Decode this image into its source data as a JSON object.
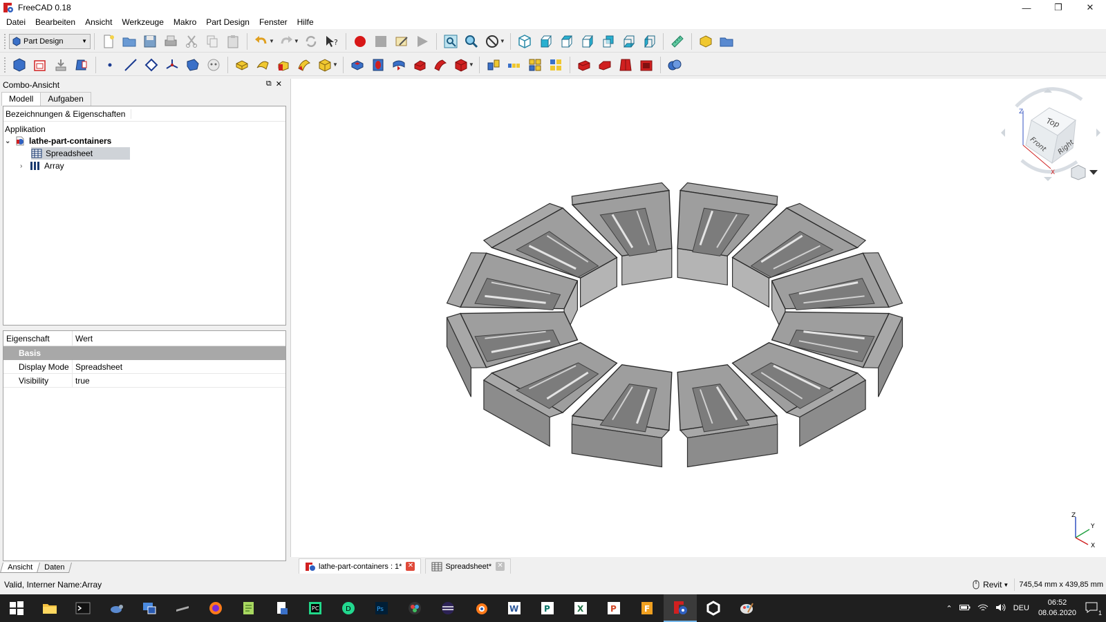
{
  "window": {
    "title": "FreeCAD 0.18"
  },
  "menu": [
    "Datei",
    "Bearbeiten",
    "Ansicht",
    "Werkzeuge",
    "Makro",
    "Part Design",
    "Fenster",
    "Hilfe"
  ],
  "toolbar": {
    "workbench": "Part Design"
  },
  "combo": {
    "title": "Combo-Ansicht",
    "tabs": [
      "Modell",
      "Aufgaben"
    ],
    "tree_header": "Bezeichnungen & Eigenschaften",
    "tree_root": "Applikation",
    "document": "lathe-part-containers",
    "items": [
      "Spreadsheet",
      "Array"
    ]
  },
  "properties": {
    "col_property": "Eigenschaft",
    "col_value": "Wert",
    "group": "Basis",
    "rows": [
      {
        "name": "Display Mode",
        "value": "Spreadsheet"
      },
      {
        "name": "Visibility",
        "value": "true"
      }
    ]
  },
  "bottom_tabs": [
    "Ansicht",
    "Daten"
  ],
  "doc_tabs": [
    "lathe-part-containers : 1*",
    "Spreadsheet*"
  ],
  "navcube": {
    "top": "Top",
    "front": "Front",
    "right": "Right"
  },
  "axis": {
    "x": "X",
    "y": "Y",
    "z": "Z"
  },
  "status": {
    "message": "Valid, Interner Name:Array",
    "nav_style": "Revit",
    "dimensions": "745,54 mm x 439,85 mm"
  },
  "taskbar": {
    "lang": "DEU",
    "time": "06:52",
    "date": "08.06.2020",
    "notifications": "1"
  },
  "colors": {
    "selection": "#cfd3d8",
    "group_header": "#a8a8a8",
    "model": "#9a9a9a",
    "taskbar": "#1f1f1f"
  }
}
